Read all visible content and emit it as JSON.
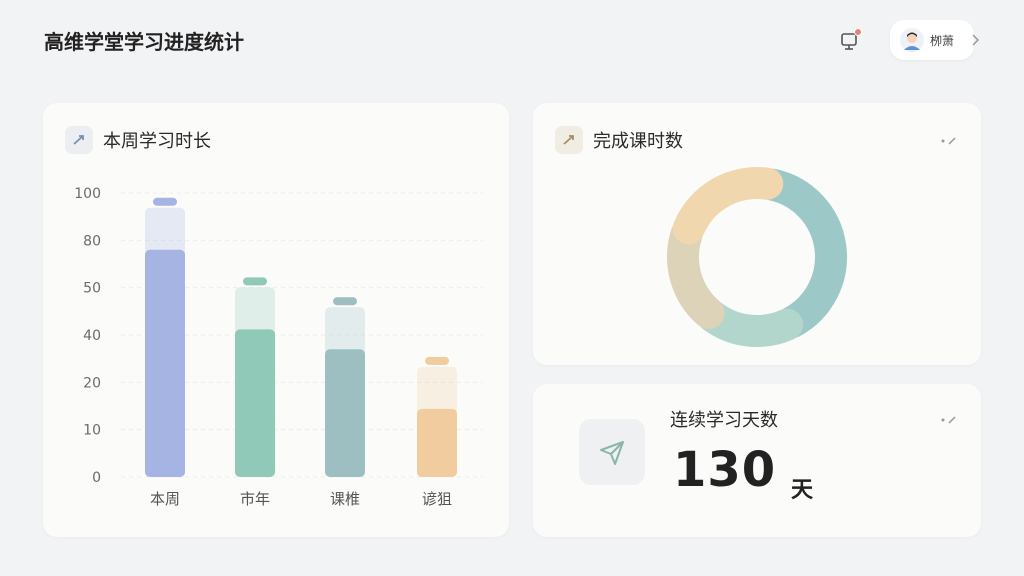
{
  "header": {
    "title": "高维学堂学习进度统计",
    "user_name": "栁萧"
  },
  "week_card": {
    "title": "本周学习时长",
    "accent": "#9aa9d8"
  },
  "lessons_card": {
    "title": "完成课时数",
    "accent": "#c9b89a"
  },
  "streak_card": {
    "title": "连续学习天数",
    "value": "130",
    "unit": "天"
  },
  "chart_data": [
    {
      "type": "bar",
      "title": "本周学习时长",
      "y_ticks": [
        "100",
        "80",
        "50",
        "40",
        "20",
        "10",
        "0"
      ],
      "categories": [
        "本周",
        "市年",
        "课椎",
        "谚狙"
      ],
      "series": [
        {
          "values": [
            80,
            52,
            45,
            24
          ]
        }
      ],
      "ylim": [
        0,
        100
      ],
      "colors": [
        "#a5b4e3",
        "#91c9b9",
        "#9dbfc2",
        "#f0cc9e"
      ],
      "grid": true
    },
    {
      "type": "pie",
      "title": "完成课时数",
      "slices": [
        {
          "value": 40,
          "color": "#9dc8c8"
        },
        {
          "value": 18,
          "color": "#b3d6cc"
        },
        {
          "value": 20,
          "color": "#dcd3b8"
        },
        {
          "value": 22,
          "color": "#f0d7ad"
        }
      ]
    }
  ]
}
